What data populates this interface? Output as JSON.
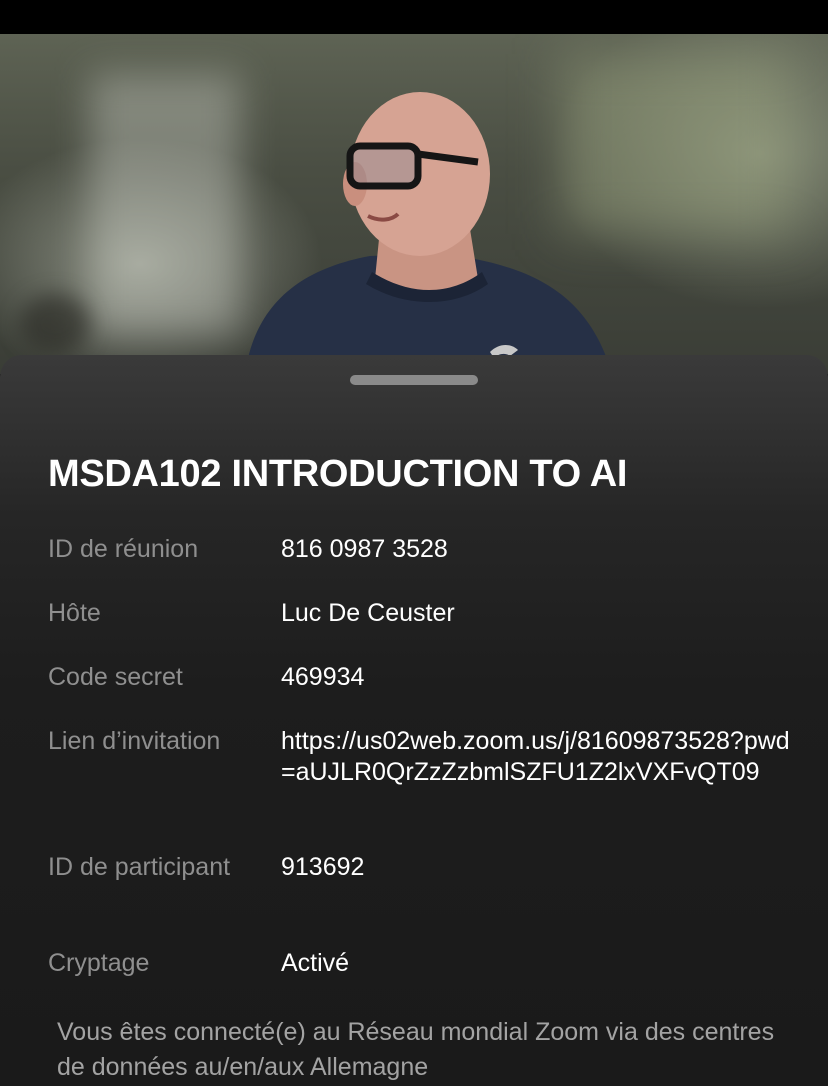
{
  "meeting": {
    "title": "MSDA102 INTRODUCTION TO AI",
    "details": [
      {
        "label": "ID de réunion",
        "value": "816 0987 3528"
      },
      {
        "label": "Hôte",
        "value": "Luc De Ceuster"
      },
      {
        "label": "Code secret",
        "value": "469934"
      },
      {
        "label": "Lien d’invitation",
        "value": "https://us02web.zoom.us/j/81609873528?pwd=aUJLR0QrZzZzbmlSZFU1Z2lxVXFvQT09"
      },
      {
        "label": "ID de participant",
        "value": "913692"
      },
      {
        "label": "Cryptage",
        "value": "Activé"
      }
    ],
    "network_notice": "Vous êtes connecté(e) au Réseau mondial Zoom via des centres de données au/en/aux Allemagne"
  }
}
